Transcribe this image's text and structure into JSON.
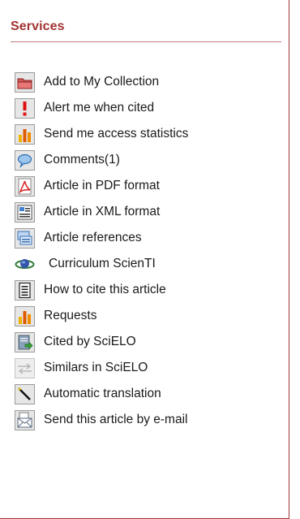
{
  "services": {
    "title": "Services",
    "items": [
      {
        "label": "Add to My Collection",
        "icon": "folder-icon"
      },
      {
        "label": "Alert me when cited",
        "icon": "alert-icon"
      },
      {
        "label": "Send me access statistics",
        "icon": "bar-chart-icon"
      },
      {
        "label": "Comments(1)",
        "icon": "comment-icon"
      },
      {
        "label": "Article in PDF format",
        "icon": "pdf-icon"
      },
      {
        "label": "Article in XML format",
        "icon": "xml-icon"
      },
      {
        "label": "Article references",
        "icon": "references-icon"
      },
      {
        "label": "Curriculum ScienTI",
        "icon": "curriculum-icon"
      },
      {
        "label": "How to cite this article",
        "icon": "document-icon"
      },
      {
        "label": "Requests",
        "icon": "bar-chart-icon"
      },
      {
        "label": "Cited by SciELO",
        "icon": "cited-by-icon"
      },
      {
        "label": "Similars in SciELO",
        "icon": "similars-icon"
      },
      {
        "label": "Automatic translation",
        "icon": "translation-icon"
      },
      {
        "label": "Send this article by e-mail",
        "icon": "email-icon"
      }
    ]
  },
  "colors": {
    "title": "#a33232",
    "border": "#a33232",
    "text": "#1a1a1a"
  }
}
